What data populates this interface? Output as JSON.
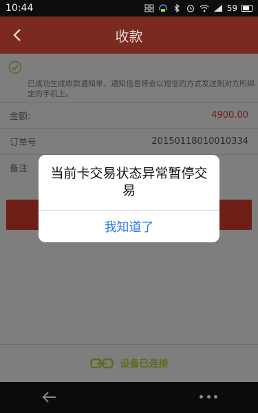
{
  "status_bar": {
    "time": "10:44",
    "battery_percent": "59",
    "icons": [
      "screenshot-icon",
      "headset-icon",
      "bluetooth-icon",
      "alarm-icon",
      "wifi-icon",
      "signal-icon",
      "battery-icon"
    ]
  },
  "header": {
    "title": "收款",
    "back_icon": "chevron-left-icon"
  },
  "notice": {
    "icon": "check-circle-icon",
    "text": "已成功生成收款通知单，通知信息将会以短信的方式发送到对方所绑定的手机上。"
  },
  "fields": [
    {
      "label": "金额:",
      "value": "4900.00"
    },
    {
      "label": "订单号",
      "value": "20150118010010334"
    },
    {
      "label": "备注",
      "value": ""
    }
  ],
  "footer": {
    "icon": "link-icon",
    "status": "设备已连接"
  },
  "dialog": {
    "message": "当前卡交易状态异常暂停交易",
    "confirm_label": "我知道了"
  },
  "colors": {
    "brand_red": "#c0392b",
    "dialog_button": "#2a7be0",
    "connected_green": "#8ca52e"
  }
}
